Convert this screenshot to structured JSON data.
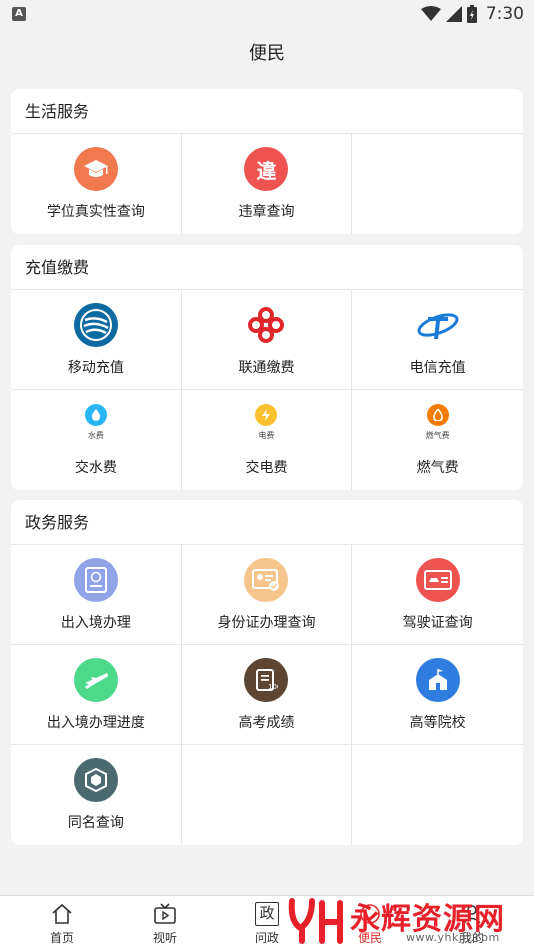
{
  "status_bar": {
    "app_badge": "A",
    "time": "7:30"
  },
  "header": {
    "title": "便民"
  },
  "sections": {
    "life": {
      "title": "生活服务",
      "items": [
        {
          "label": "学位真实性查询",
          "icon": "graduation-cap-icon",
          "color": "#f07a4e"
        },
        {
          "label": "违章查询",
          "icon": "violation-icon",
          "color": "#ef5350"
        }
      ]
    },
    "recharge": {
      "title": "充值缴费",
      "items": [
        {
          "label": "移动充值",
          "icon": "china-mobile-icon",
          "color": "#0b6aa0"
        },
        {
          "label": "联通缴费",
          "icon": "china-unicom-icon",
          "color": "#e0262b"
        },
        {
          "label": "电信充值",
          "icon": "china-telecom-icon",
          "color": "#1a7ad8"
        },
        {
          "label": "交水费",
          "caption": "水费",
          "icon": "water-drop-icon",
          "color": "#29b6f6"
        },
        {
          "label": "交电费",
          "caption": "电费",
          "icon": "lightning-icon",
          "color": "#fbc02d"
        },
        {
          "label": "燃气费",
          "caption": "燃气费",
          "icon": "flame-icon",
          "color": "#f57c00"
        }
      ]
    },
    "gov": {
      "title": "政务服务",
      "items": [
        {
          "label": "出入境办理",
          "icon": "passport-icon",
          "color": "#8fa5e8"
        },
        {
          "label": "身份证办理查询",
          "icon": "id-card-icon",
          "color": "#f5c58c"
        },
        {
          "label": "驾驶证查询",
          "icon": "driver-license-icon",
          "color": "#ef5350"
        },
        {
          "label": "出入境办理进度",
          "icon": "airplane-icon",
          "color": "#4cd98a"
        },
        {
          "label": "高考成绩",
          "icon": "exam-score-icon",
          "color": "#5d4532"
        },
        {
          "label": "高等院校",
          "icon": "university-icon",
          "color": "#2f7de1"
        },
        {
          "label": "同名查询",
          "icon": "same-name-icon",
          "color": "#4a6a6e"
        }
      ]
    }
  },
  "tabs": [
    {
      "label": "首页",
      "icon": "home-icon"
    },
    {
      "label": "视听",
      "icon": "tv-icon"
    },
    {
      "label": "问政",
      "icon": "gov-icon",
      "glyph": "政"
    },
    {
      "label": "便民",
      "icon": "convenience-icon"
    },
    {
      "label": "我的",
      "icon": "profile-icon"
    }
  ],
  "watermark": {
    "title": "永辉资源网",
    "url": "www.yhkjjt.com"
  }
}
